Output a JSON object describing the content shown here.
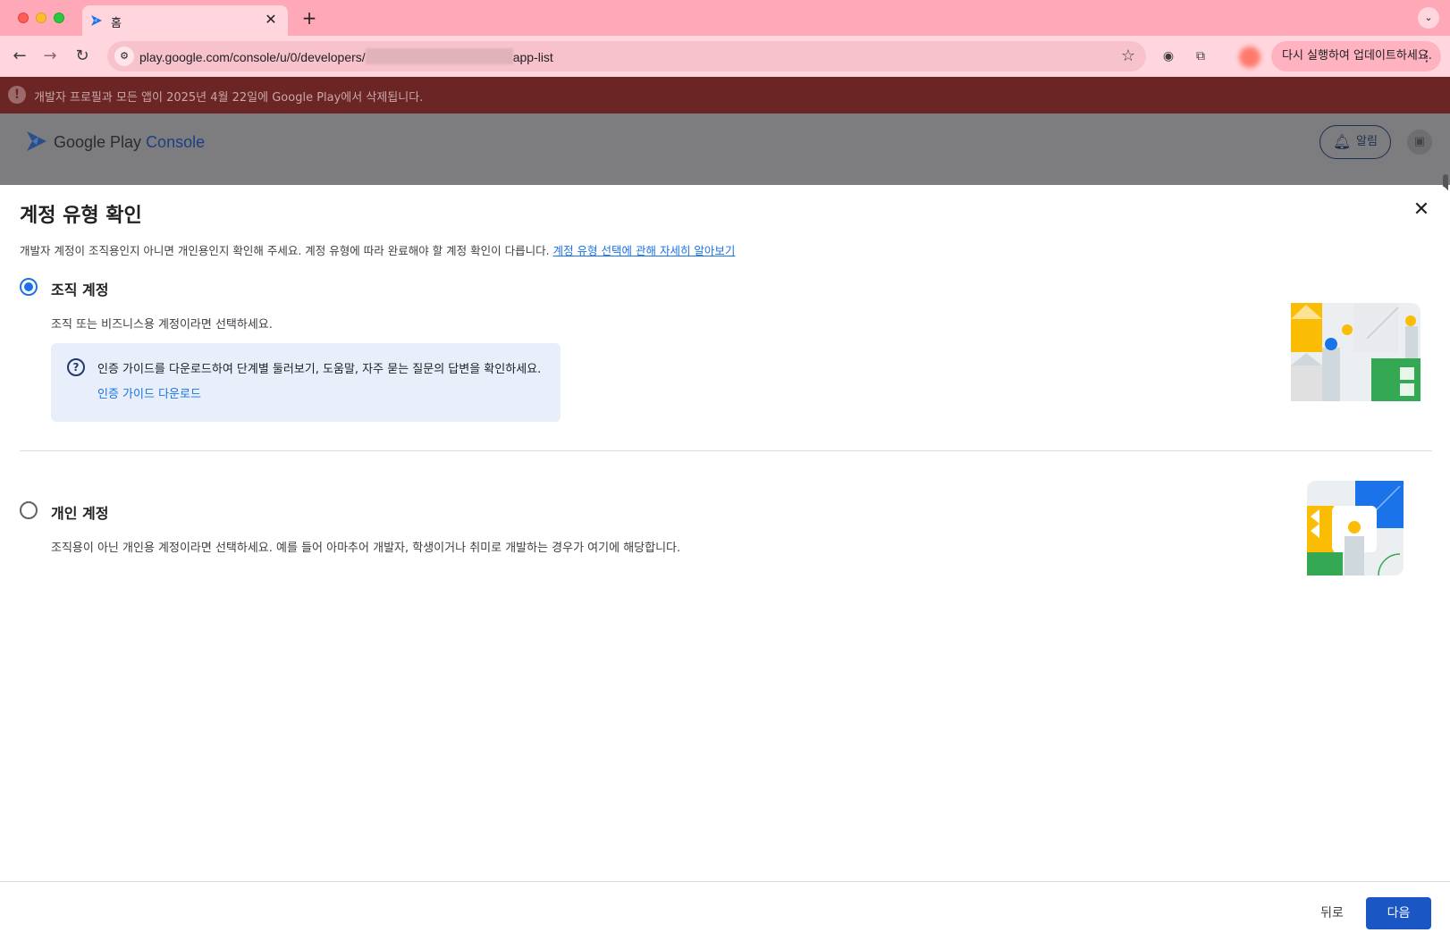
{
  "browser": {
    "tab_title": "홈",
    "tab_close": "✕",
    "new_tab": "+",
    "url_prefix": "play.google.com/console/u/0/developers/",
    "url_suffix": "app-list",
    "update_button": "다시 실행하여 업데이트하세요.",
    "icons": [
      "back-icon",
      "forward-icon",
      "reload-icon",
      "site-info-icon",
      "star-icon",
      "password-icon",
      "extensions-icon",
      "more-icon"
    ]
  },
  "banner": {
    "text": "개발자 프로필과 모든 앱이 2025년 4월 22일에 Google Play에서 삭제됩니다."
  },
  "console": {
    "title_main": "Google Play ",
    "title_accent": "Console",
    "notifications_label": "알림"
  },
  "dialog": {
    "title": "계정 유형 확인",
    "description": "개발자 계정이 조직용인지 아니면 개인용인지 확인해 주세요. 계정 유형에 따라 완료해야 할 계정 확인이 다릅니다. ",
    "learn_more_link": "계정 유형 선택에 관해 자세히 알아보기",
    "options": [
      {
        "label": "조직 계정",
        "description": "조직 또는 비즈니스용 계정이라면 선택하세요.",
        "selected": true
      },
      {
        "label": "개인 계정",
        "description": "조직용이 아닌 개인용 계정이라면 선택하세요. 예를 들어 아마추어 개발자, 학생이거나 취미로 개발하는 경우가 여기에 해당합니다.",
        "selected": false
      }
    ],
    "info_box": {
      "text": "인증 가이드를 다운로드하여 단계별 둘러보기, 도움말, 자주 묻는 질문의 답변을 확인하세요.",
      "link": "인증 가이드 다운로드"
    },
    "back_button": "뒤로",
    "next_button": "다음"
  },
  "colors": {
    "accent": "#1a73e8",
    "primary_button": "#1a56c4",
    "banner": "#6b2525",
    "tabbar": "#ffa8b8"
  }
}
